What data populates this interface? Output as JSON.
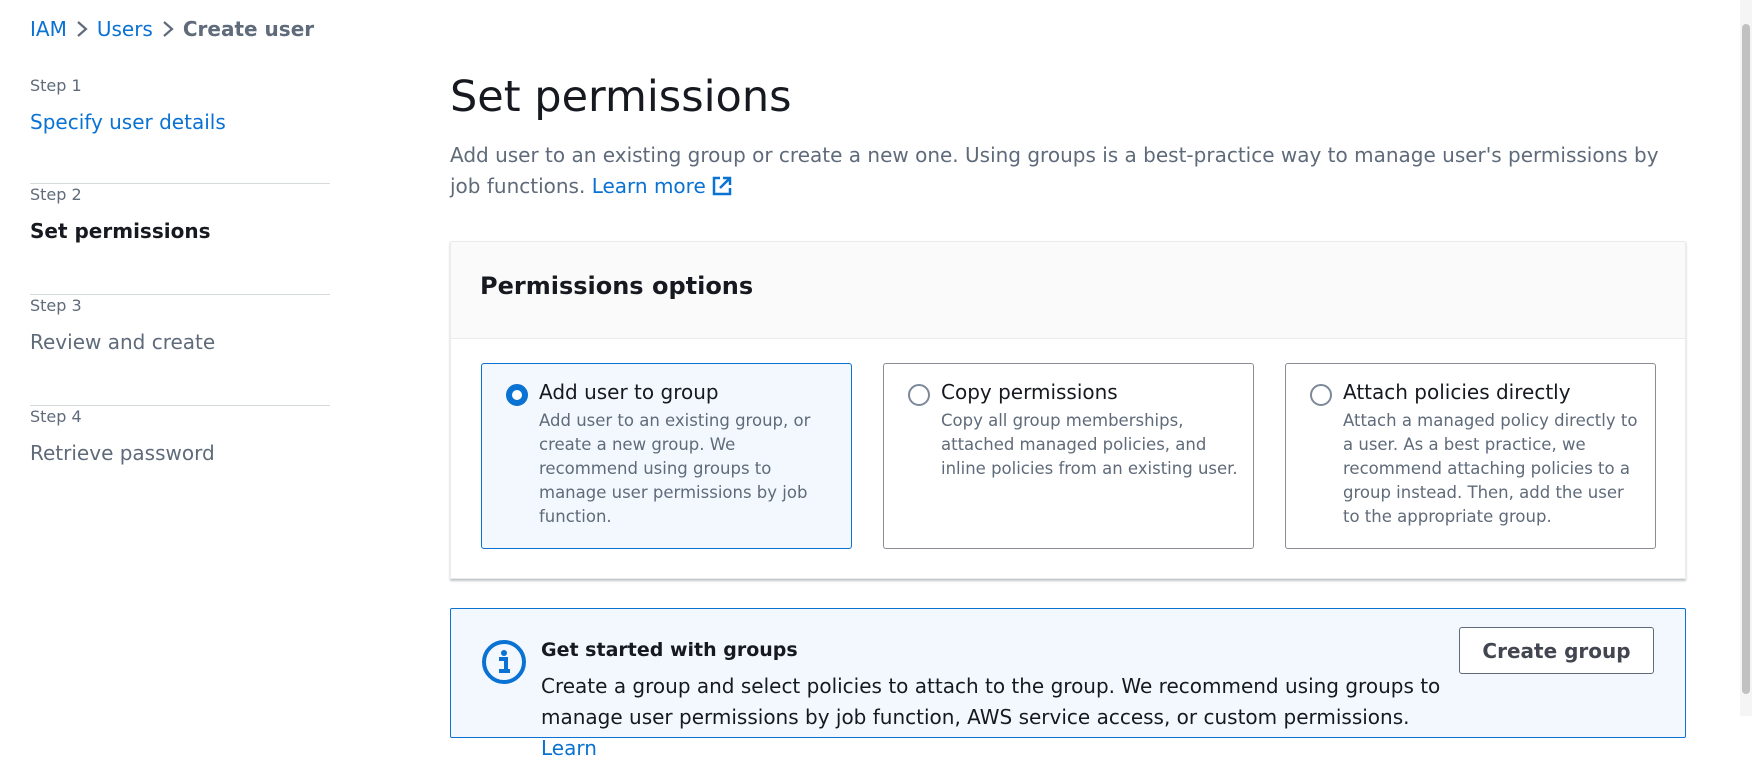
{
  "breadcrumb": {
    "iam": "IAM",
    "users": "Users",
    "current": "Create user"
  },
  "steps": [
    {
      "num": "Step 1",
      "label": "Specify user details"
    },
    {
      "num": "Step 2",
      "label": "Set permissions"
    },
    {
      "num": "Step 3",
      "label": "Review and create"
    },
    {
      "num": "Step 4",
      "label": "Retrieve password"
    }
  ],
  "main": {
    "title": "Set permissions",
    "description": "Add user to an existing group or create a new one. Using groups is a best-practice way to manage user's permissions by job functions.",
    "learn_more": "Learn more"
  },
  "permissions": {
    "header": "Permissions options",
    "options": [
      {
        "title": "Add user to group",
        "desc": "Add user to an existing group, or create a new group. We recommend using groups to manage user permissions by job function.",
        "selected": true
      },
      {
        "title": "Copy permissions",
        "desc": "Copy all group memberships, attached managed policies, and inline policies from an existing user.",
        "selected": false
      },
      {
        "title": "Attach policies directly",
        "desc": "Attach a managed policy directly to a user. As a best practice, we recommend attaching policies to a group instead. Then, add the user to the appropriate group.",
        "selected": false
      }
    ]
  },
  "alert": {
    "title": "Get started with groups",
    "text": "Create a group and select policies to attach to the group. We recommend using groups to manage user permissions by job function, AWS service access, or custom permissions.",
    "learn": "Learn",
    "button": "Create group"
  },
  "colors": {
    "link": "#0972d3",
    "selected_bg": "#f2f8fd",
    "muted_text": "#5f6b7a"
  }
}
